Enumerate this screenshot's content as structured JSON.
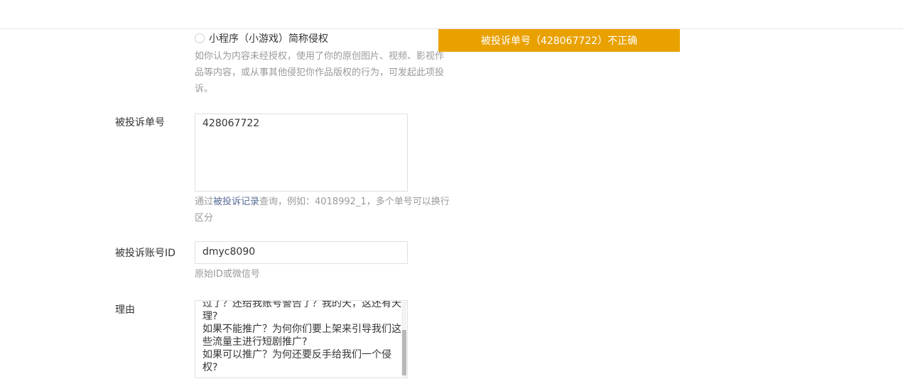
{
  "toast": {
    "text": "被投诉单号（428067722）不正确"
  },
  "type_option": {
    "label": "小程序（小游戏）简称侵权",
    "selected": false
  },
  "type_desc": "如你认为内容未经授权，使用了你的原创图片、视频、影视作品等内容，或从事其他侵犯你作品版权的行为，可发起此项投诉。",
  "complaint_no": {
    "label": "被投诉单号",
    "value": "428067722",
    "hint_prefix": "通过",
    "hint_link": "被投诉记录",
    "hint_suffix": "查询，例如：4018992_1，多个单号可以换行区分"
  },
  "account_id": {
    "label": "被投诉账号ID",
    "value": "dmyc8090",
    "hint": "原始ID或微信号"
  },
  "reason": {
    "label": "理由",
    "lines": [
      "过了？还给我账号警告了？我的天，这还有天",
      "理?",
      "如果不能推广？为何你们要上架来引导我们这",
      "些流量主进行短剧推广?",
      "如果可以推广？为何还要反手给我们一个侵",
      "权?"
    ]
  },
  "colors": {
    "toast_bg": "#e9a100",
    "link": "#576b95",
    "hint": "#9a9a9a"
  }
}
